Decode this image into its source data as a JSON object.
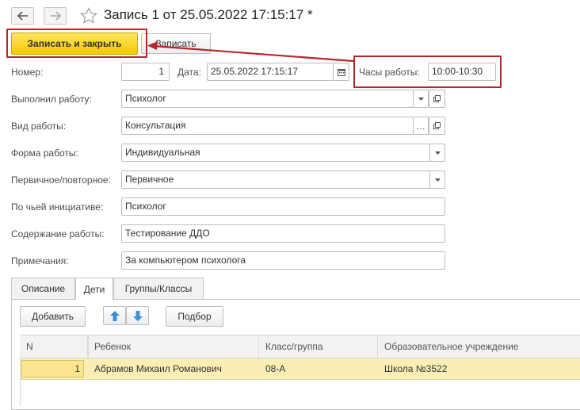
{
  "window": {
    "title": "Запись 1 от 25.05.2022 17:15:17 *"
  },
  "toolbar": {
    "save_close_label": "Записать и закрыть",
    "save_label": "Записать"
  },
  "form": {
    "number_label": "Номер:",
    "number_value": "1",
    "date_label": "Дата:",
    "date_value": "25.05.2022 17:15:17",
    "hours_label": "Часы работы:",
    "hours_value": "10:00-10:30",
    "performer_label": "Выполнил работу:",
    "performer_value": "Психолог",
    "work_type_label": "Вид работы:",
    "work_type_value": "Консультация",
    "work_form_label": "Форма работы:",
    "work_form_value": "Индивидуальная",
    "primary_label": "Первичное/повторное:",
    "primary_value": "Первичное",
    "initiative_label": "По чьей инициативе:",
    "initiative_value": "Психолог",
    "content_label": "Содержание работы:",
    "content_value": "Тестирование ДДО",
    "notes_label": "Примечания:",
    "notes_value": "За компьютером психолога"
  },
  "tabs": [
    {
      "label": "Описание"
    },
    {
      "label": "Дети"
    },
    {
      "label": "Группы/Классы"
    }
  ],
  "tab_toolbar": {
    "add_label": "Добавить",
    "pick_label": "Подбор"
  },
  "table": {
    "columns": [
      "N",
      "Ребенок",
      "Класс/группа",
      "Образовательное учреждение"
    ],
    "rows": [
      [
        "1",
        "Абрамов Михаил Романович",
        "08-А",
        "Школа №3522"
      ]
    ]
  },
  "colors": {
    "accent_yellow": "#f3c900",
    "highlight_red": "#b5262b",
    "selected_row": "#fbeeb4",
    "arrow_blue": "#3a8fd6"
  }
}
